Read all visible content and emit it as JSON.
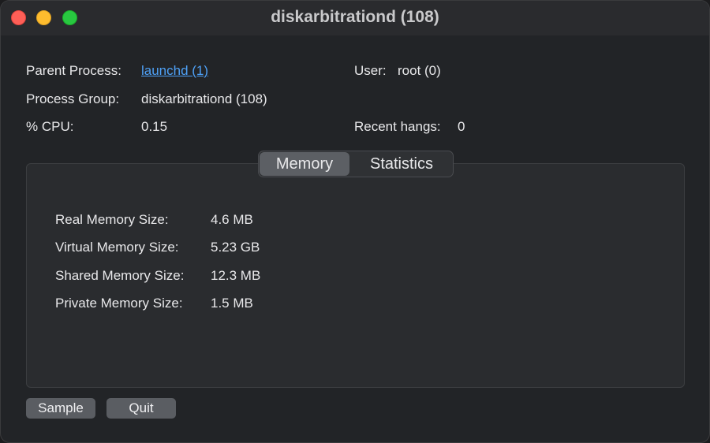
{
  "window": {
    "title": "diskarbitrationd (108)"
  },
  "info": {
    "parent_process_label": "Parent Process:",
    "parent_process_value": "launchd (1)",
    "process_group_label": "Process Group:",
    "process_group_value": "diskarbitrationd (108)",
    "cpu_label": "% CPU:",
    "cpu_value": "0.15",
    "user_label": "User:",
    "user_value": "root (0)",
    "recent_hangs_label": "Recent hangs:",
    "recent_hangs_value": "0"
  },
  "tabs": {
    "memory": "Memory",
    "statistics": "Statistics",
    "selected": "Memory"
  },
  "memory": {
    "rows": [
      {
        "label": "Real Memory Size:",
        "value": "4.6 MB"
      },
      {
        "label": "Virtual Memory Size:",
        "value": "5.23 GB"
      },
      {
        "label": "Shared Memory Size:",
        "value": "12.3 MB"
      },
      {
        "label": "Private Memory Size:",
        "value": "1.5 MB"
      }
    ]
  },
  "buttons": {
    "sample": "Sample",
    "quit": "Quit"
  },
  "colors": {
    "link": "#4ea0f5",
    "close": "#fe5f57",
    "minimize": "#febc2e",
    "maximize": "#28c840",
    "selected_tab": "#5c5f64"
  }
}
